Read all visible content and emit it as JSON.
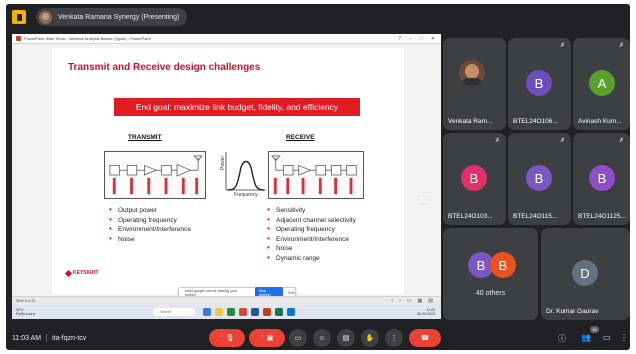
{
  "topbar": {
    "presenter": "Venkata Ramana Synergy (Presenting)"
  },
  "powerpoint": {
    "window_title": "PowerPoint Slide Show - Network Analysis Basics (Typist) - PowerPoint",
    "slide_status": "Slide 8 of 30",
    "share_notice": "meet.google.com is sharing your screen.",
    "stop_sharing": "Stop sharing",
    "hide": "Hide",
    "taskbar": {
      "weather_temp": "32°C",
      "weather_desc": "Partly sunny",
      "search": "Search",
      "time": "11:03",
      "date": "30-09-2023"
    }
  },
  "slide": {
    "title": "Transmit and Receive design challenges",
    "goal": "End goal: maximize link budget, fidelity, and efficiency",
    "transmit": {
      "heading": "TRANSMIT",
      "bullets": [
        "Output power",
        "Operating frequency",
        "Environment/Interference",
        "Noise"
      ]
    },
    "receive": {
      "heading": "RECEIVE",
      "bullets": [
        "Sensitivity",
        "Adjacent channel selectivity",
        "Operating frequency",
        "Environment/Interference",
        "Noise",
        "Dynamic range"
      ]
    },
    "spectrum": {
      "xlabel": "Frequency",
      "ylabel": "Power"
    },
    "logo": "KEYSIGHT"
  },
  "participants": [
    {
      "name": "Venkata Ram...",
      "letter": "",
      "color": "#3c4043"
    },
    {
      "name": "BTEL24O106...",
      "letter": "B",
      "color": "#6b4fbb"
    },
    {
      "name": "Avinash Kum...",
      "letter": "A",
      "color": "#5aa02c"
    },
    {
      "name": "BTEL24O103...",
      "letter": "B",
      "color": "#e2306c"
    },
    {
      "name": "BTEL24O115...",
      "letter": "B",
      "color": "#7b57c2"
    },
    {
      "name": "BTEL24O1125...",
      "letter": "B",
      "color": "#8e4fc7"
    },
    {
      "name": "Dr. Kumar Gaurav",
      "letter": "D",
      "color": "#637181"
    }
  ],
  "others": {
    "label": "40 others",
    "letters": [
      "B",
      "B"
    ],
    "colors": [
      "#7b57c2",
      "#e8531f"
    ]
  },
  "bottombar": {
    "time": "11:03 AM",
    "meeting_code": "ita-fqzn-tcv",
    "participant_count": "48"
  },
  "colors": {
    "accent_red": "#ea4335",
    "tile_bg": "#3c4043"
  }
}
